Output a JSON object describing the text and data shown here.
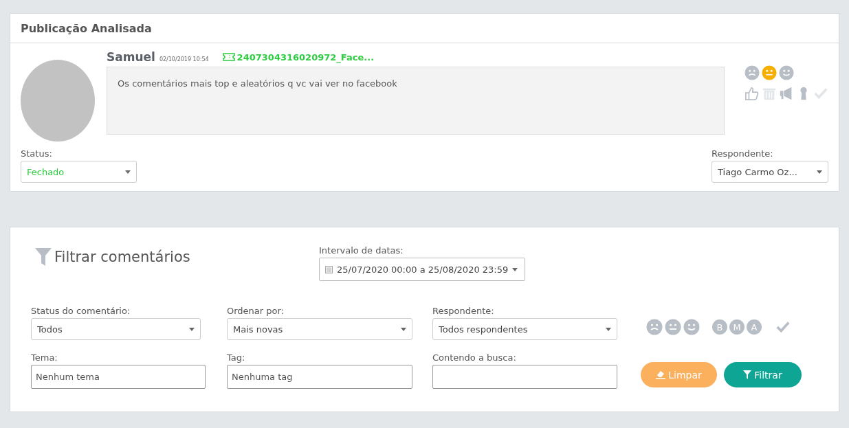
{
  "post_panel": {
    "title": "Publicação Analisada",
    "author": "Samuel",
    "timestamp": "02/10/2019 10:54",
    "ticket": "2407304316020972_Face...",
    "message": "Os comentários mais top e aleatórios q vc vai ver no facebook",
    "sentiments": [
      {
        "kind": "sad",
        "selected": false
      },
      {
        "kind": "neutral",
        "selected": true
      },
      {
        "kind": "happy",
        "selected": false
      }
    ],
    "actions": [
      {
        "kind": "like",
        "disabled": false
      },
      {
        "kind": "trash",
        "disabled": true
      },
      {
        "kind": "megaphone",
        "disabled": false
      },
      {
        "kind": "keyhole",
        "disabled": false
      },
      {
        "kind": "check",
        "disabled": true
      }
    ],
    "status": {
      "label": "Status:",
      "value": "Fechado"
    },
    "respondent": {
      "label": "Respondente:",
      "value": "Tiago Carmo Oz..."
    }
  },
  "filter_panel": {
    "title": "Filtrar comentários",
    "date_range": {
      "label": "Intervalo de datas:",
      "value": "25/07/2020 00:00 a 25/08/2020 23:59"
    },
    "selects": [
      {
        "label": "Status do comentário:",
        "value": "Todos"
      },
      {
        "label": "Ordenar por:",
        "value": "Mais novas"
      },
      {
        "label": "Respondente:",
        "value": "Todos respondentes"
      }
    ],
    "sentiments": [
      {
        "kind": "sad",
        "selected": false
      },
      {
        "kind": "neutral",
        "selected": false
      },
      {
        "kind": "happy",
        "selected": false
      }
    ],
    "levels": [
      {
        "letter": "B",
        "selected": false
      },
      {
        "letter": "M",
        "selected": false
      },
      {
        "letter": "A",
        "selected": false
      }
    ],
    "inputs": [
      {
        "label": "Tema:",
        "placeholder": "Nenhum tema"
      },
      {
        "label": "Tag:",
        "placeholder": "Nenhuma tag"
      },
      {
        "label": "Contendo a busca:"
      }
    ],
    "buttons": [
      {
        "kind": "clear",
        "label": "Limpar"
      },
      {
        "kind": "filter",
        "label": "Filtrar"
      }
    ]
  }
}
